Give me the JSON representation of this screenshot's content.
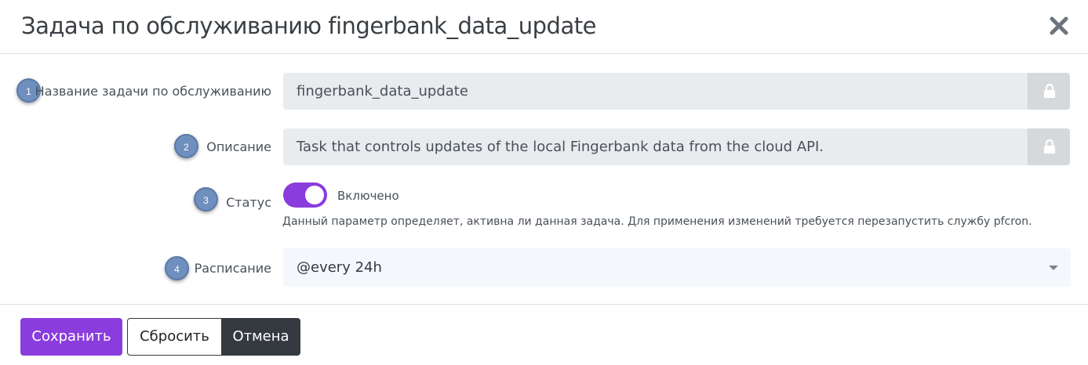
{
  "dialog": {
    "title": "Задача по обслуживанию fingerbank_data_update",
    "close_icon": "close-icon"
  },
  "fields": {
    "name": {
      "step": "1",
      "label": "Название задачи по обслуживанию",
      "value": "fingerbank_data_update",
      "locked": true
    },
    "description": {
      "step": "2",
      "label": "Описание",
      "value": "Task that controls updates of the local Fingerbank data from the cloud API.",
      "locked": true
    },
    "status": {
      "step": "3",
      "label": "Статус",
      "toggle_text": "Включено",
      "enabled": true,
      "help": "Данный параметр определяет, активна ли данная задача. Для применения изменений требуется перезапустить службу pfcron."
    },
    "schedule": {
      "step": "4",
      "label": "Расписание",
      "value": "@every 24h"
    }
  },
  "buttons": {
    "save": "Сохранить",
    "reset": "Сбросить",
    "cancel": "Отмена"
  },
  "colors": {
    "accent": "#8a3cdc",
    "badge": "#6f8fbe",
    "dark": "#343a40"
  }
}
